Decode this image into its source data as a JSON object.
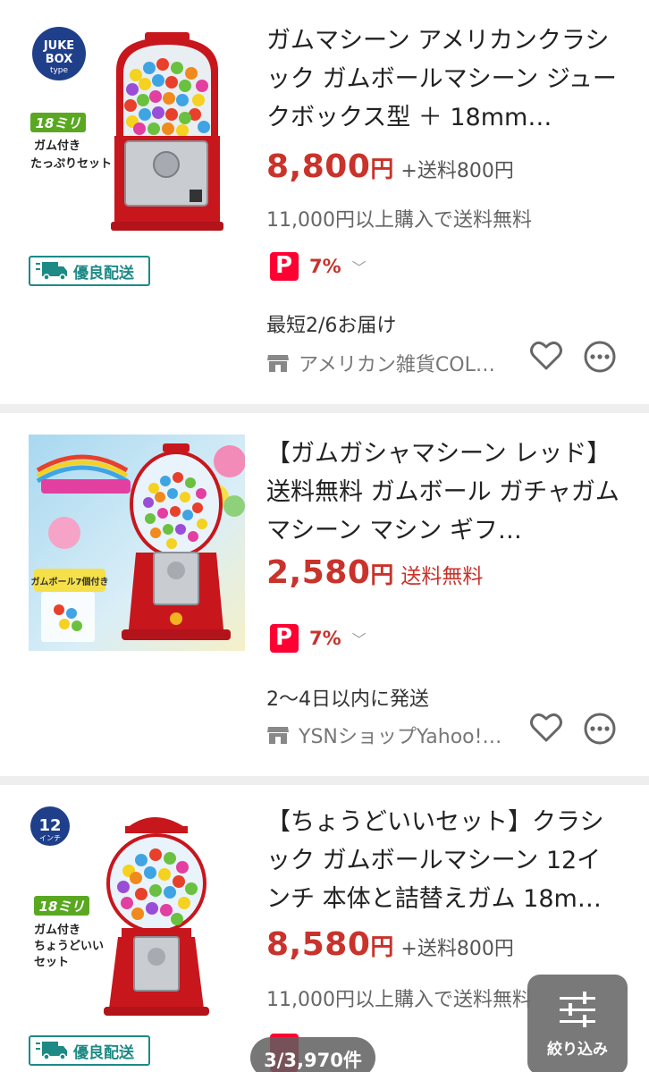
{
  "items": [
    {
      "title": "ガムマシーン アメリカンクラシック ガムボールマシーン ジュークボックス型 ＋ 18mm…",
      "price": "8,800",
      "yen": "円",
      "shipping": "+送料800円",
      "note": "11,000円以上購入で送料無料",
      "paypay_rate": "7%",
      "delivery": "最短2/6お届け",
      "store": "アメリカン雑貨COL…",
      "badge": "優良配送",
      "thumb_text": {
        "top": "JUKE",
        "mid": "BOX",
        "bot": "type",
        "size": "18ミリ",
        "desc1": "ガム付き",
        "desc2": "たっぷりセット"
      }
    },
    {
      "title": "【ガムガシャマシーン レッド】送料無料 ガムボール ガチャガム マシーン マシン ギフ…",
      "price": "2,580",
      "yen": "円",
      "shipping": "送料無料",
      "paypay_rate": "7%",
      "delivery": "2〜4日以内に発送",
      "store": "YSNショップYahoo!…",
      "thumb_text": {
        "banner": "ガムボール7個付き"
      }
    },
    {
      "title": "【ちょうどいいセット】クラシック ガムボールマシーン 12インチ 本体と詰替えガム 18m…",
      "price": "8,580",
      "yen": "円",
      "shipping": "+送料800円",
      "note": "11,000円以上購入で送料無料",
      "badge": "優良配送",
      "thumb_text": {
        "inch": "12",
        "inch_unit": "インチ",
        "size": "18ミリ",
        "desc1": "ガム付き",
        "desc2": "ちょうどいい",
        "desc3": "セット"
      }
    }
  ],
  "pager": {
    "count": "3/3,970件"
  },
  "filter": {
    "label": "絞り込み"
  },
  "colors": {
    "price": "#c8332b",
    "paypay": "#ff0033",
    "badge": "#1d8a85"
  }
}
